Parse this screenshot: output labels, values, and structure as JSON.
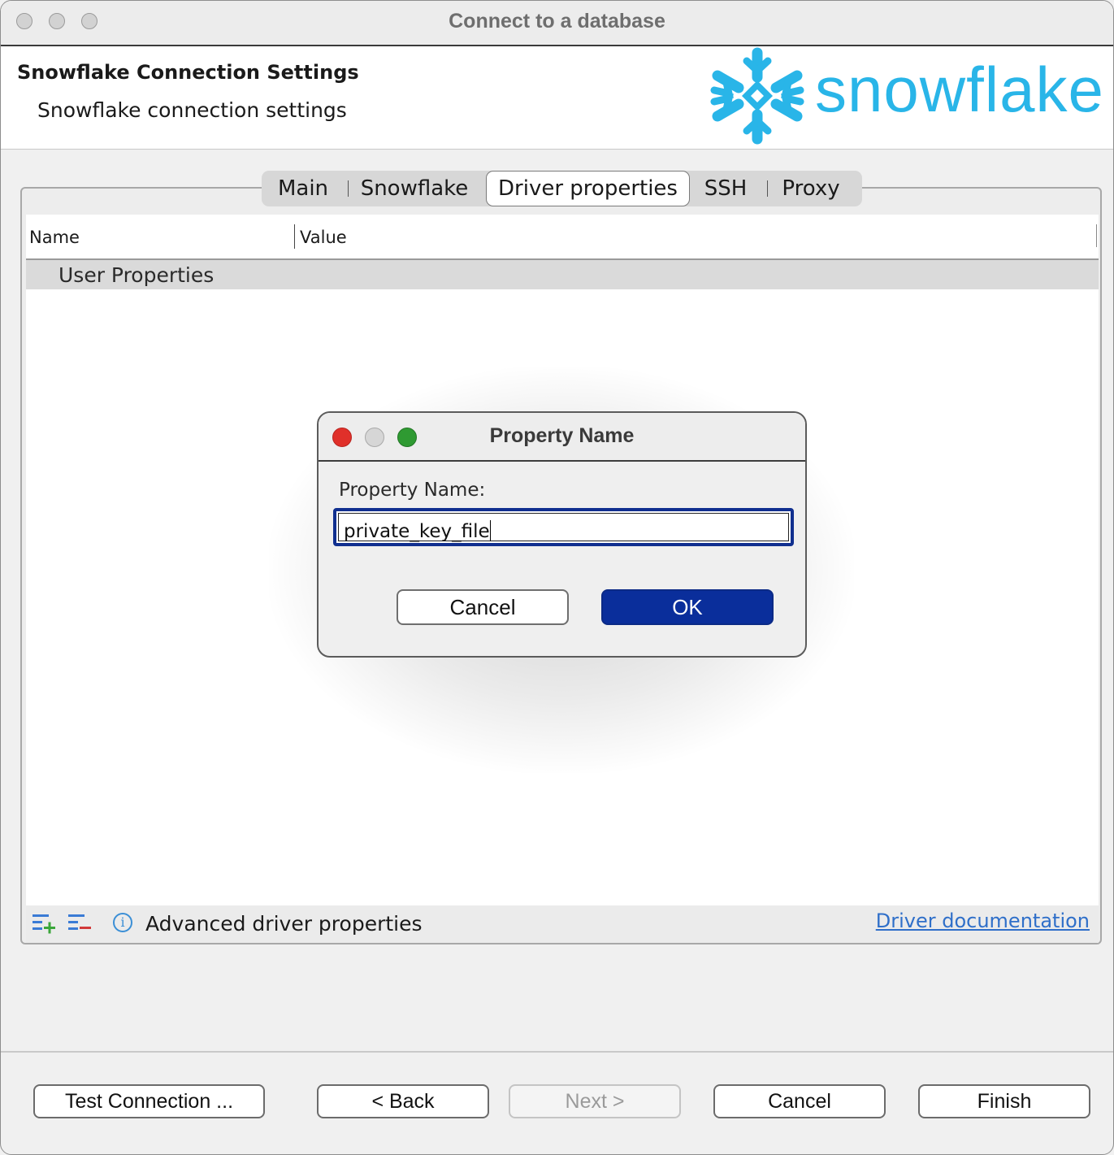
{
  "window": {
    "title": "Connect to a database"
  },
  "header": {
    "title": "Snowflake Connection Settings",
    "subtitle": "Snowflake connection settings",
    "logo_text": "snowflake",
    "brand_color": "#29b5e8"
  },
  "tabs": [
    {
      "label": "Main",
      "active": false
    },
    {
      "label": "Snowflake",
      "active": false
    },
    {
      "label": "Driver properties",
      "active": true
    },
    {
      "label": "SSH",
      "active": false
    },
    {
      "label": "Proxy",
      "active": false
    }
  ],
  "table": {
    "columns": [
      "Name",
      "Value"
    ],
    "group_label": "User Properties"
  },
  "tools": {
    "add_icon": "add-property-icon",
    "remove_icon": "remove-property-icon",
    "info_icon": "info-icon",
    "advanced_label": "Advanced driver properties",
    "doc_link": "Driver documentation"
  },
  "footer": {
    "test_connection": "Test Connection ...",
    "back": "< Back",
    "next": "Next >",
    "cancel": "Cancel",
    "finish": "Finish"
  },
  "dialog": {
    "title": "Property Name",
    "label": "Property Name:",
    "input_value": "private_key_file",
    "cancel": "Cancel",
    "ok": "OK",
    "ok_color": "#0a2e9b"
  }
}
